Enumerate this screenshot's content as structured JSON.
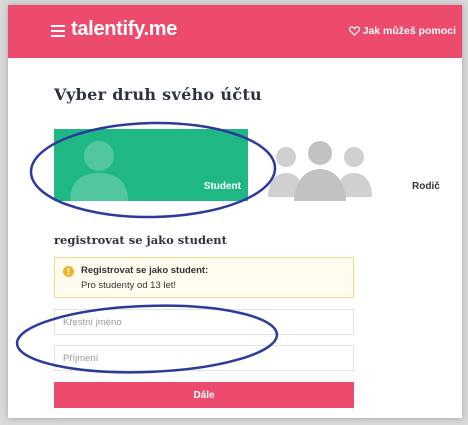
{
  "header": {
    "logo": "talentify.me",
    "help_link": "Jak můžeš pomoci"
  },
  "page": {
    "title": "Vyber druh svého účtu"
  },
  "account_types": [
    {
      "label": "Student",
      "selected": true
    },
    {
      "label": "Rodič",
      "selected": false
    }
  ],
  "section": {
    "title": "registrovat se jako student"
  },
  "info": {
    "title": "Registrovat se jako student:",
    "text": "Pro studenty od 13 let!"
  },
  "form": {
    "first_name_placeholder": "Křestní jméno",
    "last_name_placeholder": "Příjmení",
    "submit_label": "Dále"
  },
  "colors": {
    "brand": "#ec4b6e",
    "student_card": "#1fb885",
    "info_border": "#f4dc8c",
    "annotation": "#2c3a9c"
  },
  "icons": {
    "menu": "menu-icon",
    "heart": "heart-icon",
    "student_avatar": "user-avatar-icon",
    "parent_group": "user-group-icon",
    "info": "info-icon"
  }
}
